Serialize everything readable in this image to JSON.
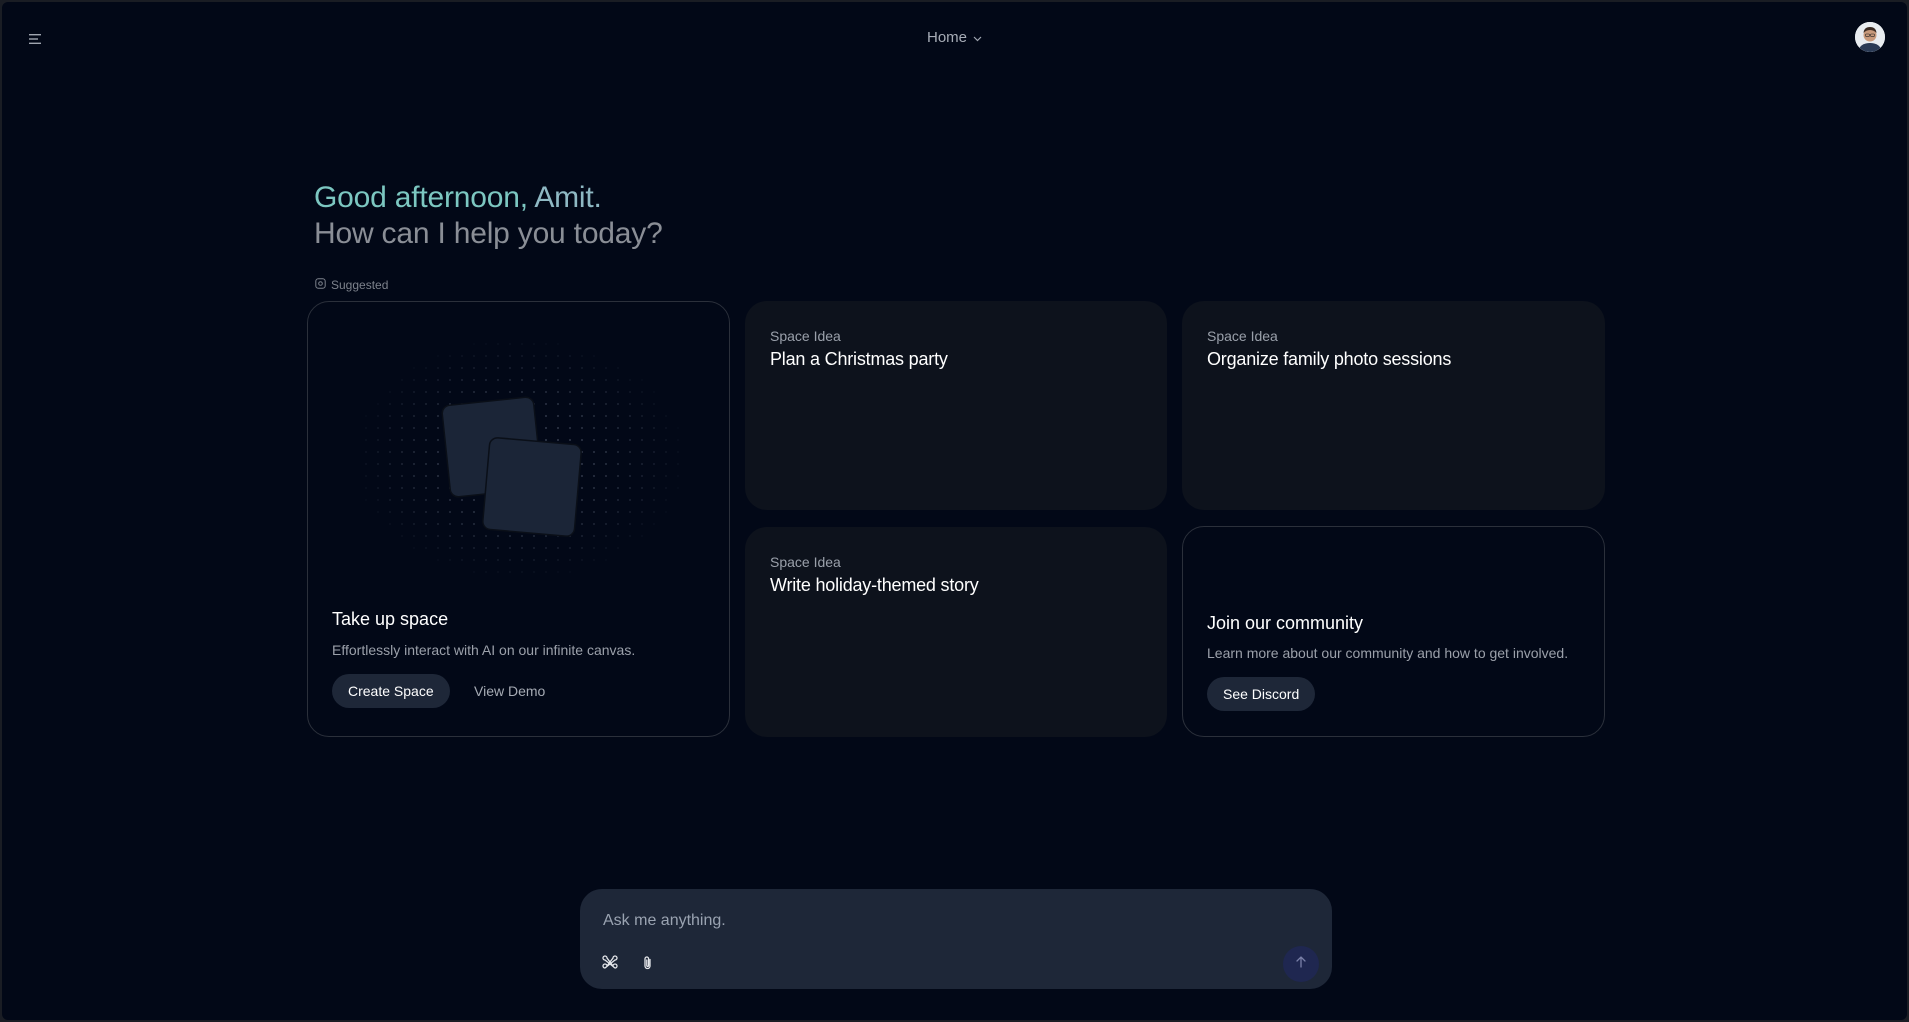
{
  "header": {
    "nav_label": "Home",
    "avatar": "user-avatar"
  },
  "greeting": {
    "line1_prefix": "Good afternoon, ",
    "line1_name": "Amit.",
    "line2": "How can I help you today?"
  },
  "suggested_label": "Suggested",
  "feature_card": {
    "title": "Take up space",
    "description": "Effortlessly interact with AI on our infinite canvas.",
    "primary_button": "Create Space",
    "secondary_button": "View Demo"
  },
  "space_ideas": [
    {
      "eyebrow": "Space Idea",
      "title": "Plan a Christmas party"
    },
    {
      "eyebrow": "Space Idea",
      "title": "Organize family photo sessions"
    },
    {
      "eyebrow": "Space Idea",
      "title": "Write holiday-themed story"
    }
  ],
  "community_card": {
    "title": "Join our community",
    "description": "Learn more about our community and how to get involved.",
    "button": "See Discord"
  },
  "chat": {
    "placeholder": "Ask me anything."
  },
  "colors": {
    "background": "#020817",
    "card": "#0d121c",
    "accent_greeting": "#7cc7c1",
    "chat_bg": "#1e2738"
  }
}
